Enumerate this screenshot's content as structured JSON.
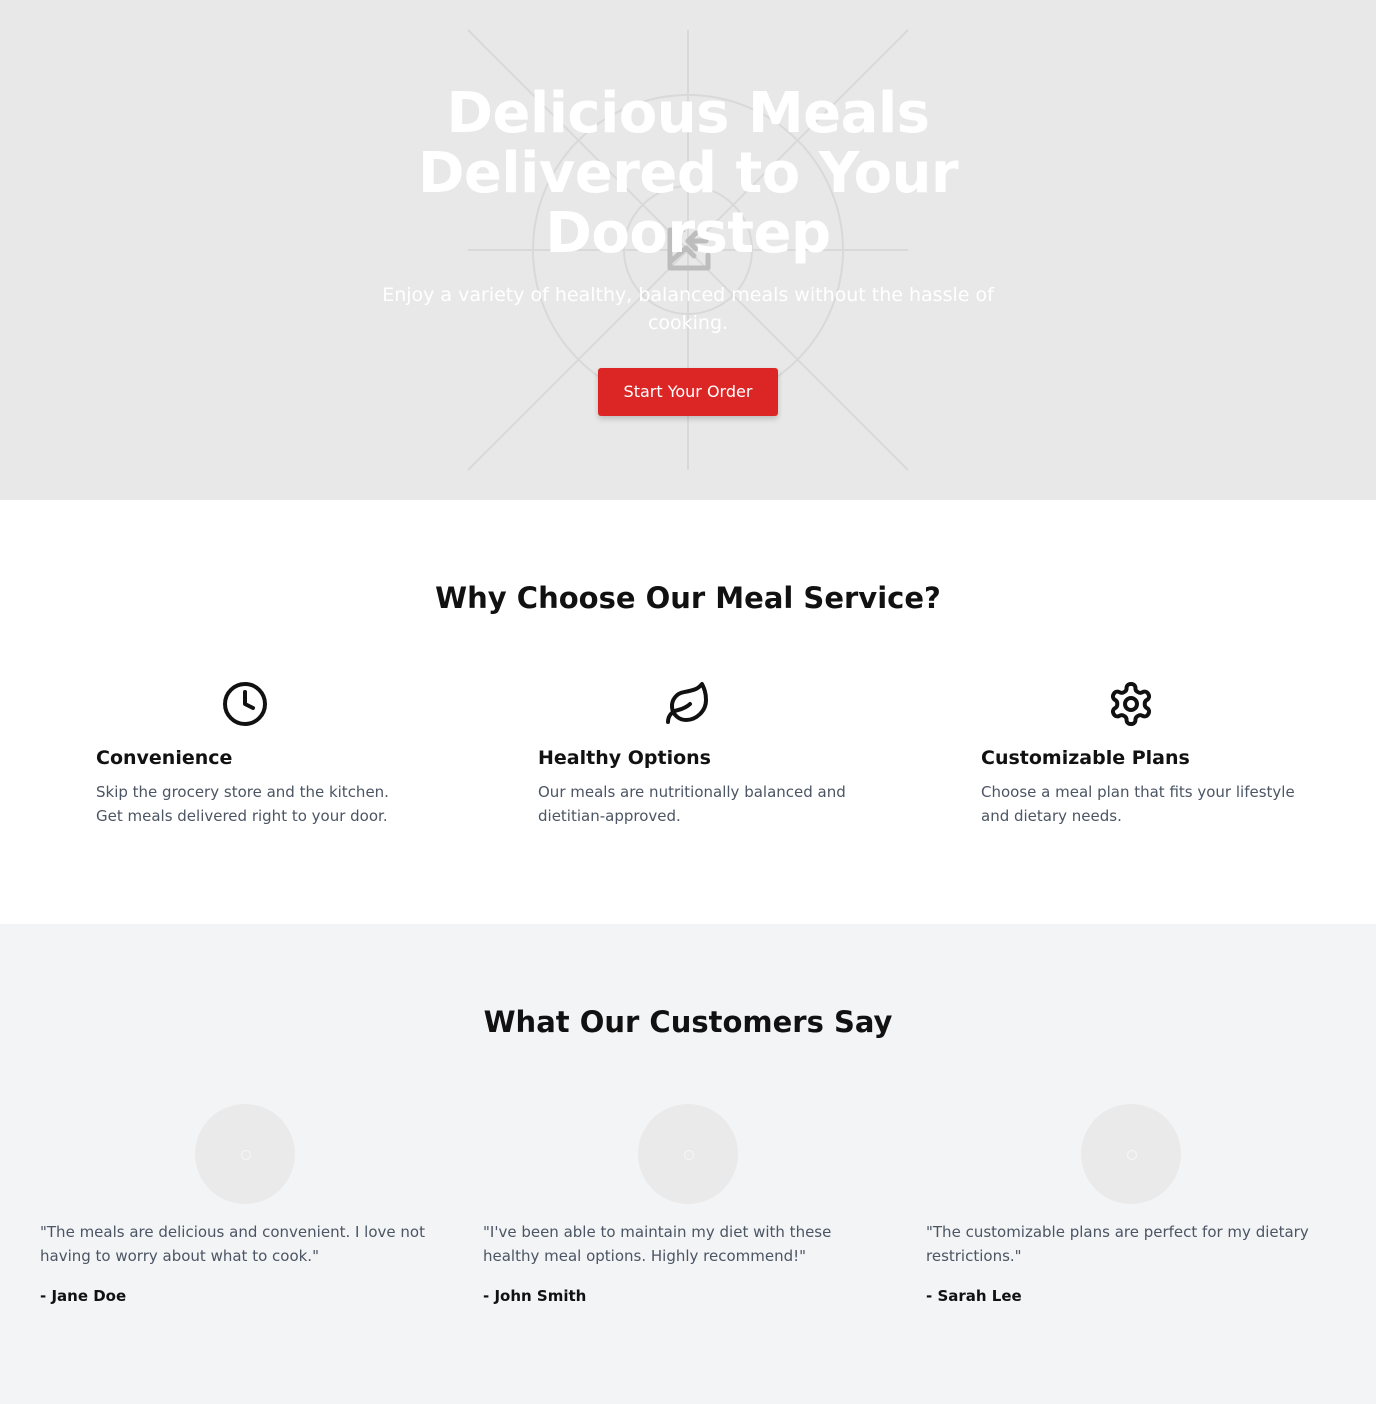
{
  "hero": {
    "title": "Delicious Meals Delivered to Your Doorstep",
    "subtitle": "Enjoy a variety of healthy, balanced meals without the hassle of cooking.",
    "cta_label": "Start Your Order",
    "background_icon": "image-placeholder-icon",
    "cta_color": "#dc2626"
  },
  "features": {
    "title": "Why Choose Our Meal Service?",
    "items": [
      {
        "icon": "clock-icon",
        "title": "Convenience",
        "text": "Skip the grocery store and the kitchen. Get meals delivered right to your door."
      },
      {
        "icon": "leaf-icon",
        "title": "Healthy Options",
        "text": "Our meals are nutritionally balanced and dietitian-approved."
      },
      {
        "icon": "gear-icon",
        "title": "Customizable Plans",
        "text": "Choose a meal plan that fits your lifestyle and dietary needs."
      }
    ]
  },
  "testimonials": {
    "title": "What Our Customers Say",
    "items": [
      {
        "quote": "\"The meals are delicious and convenient. I love not having to worry about what to cook.\"",
        "author": "- Jane Doe"
      },
      {
        "quote": "\"I've been able to maintain my diet with these healthy meal options. Highly recommend!\"",
        "author": "- John Smith"
      },
      {
        "quote": "\"The customizable plans are perfect for my dietary restrictions.\"",
        "author": "- Sarah Lee"
      }
    ]
  }
}
